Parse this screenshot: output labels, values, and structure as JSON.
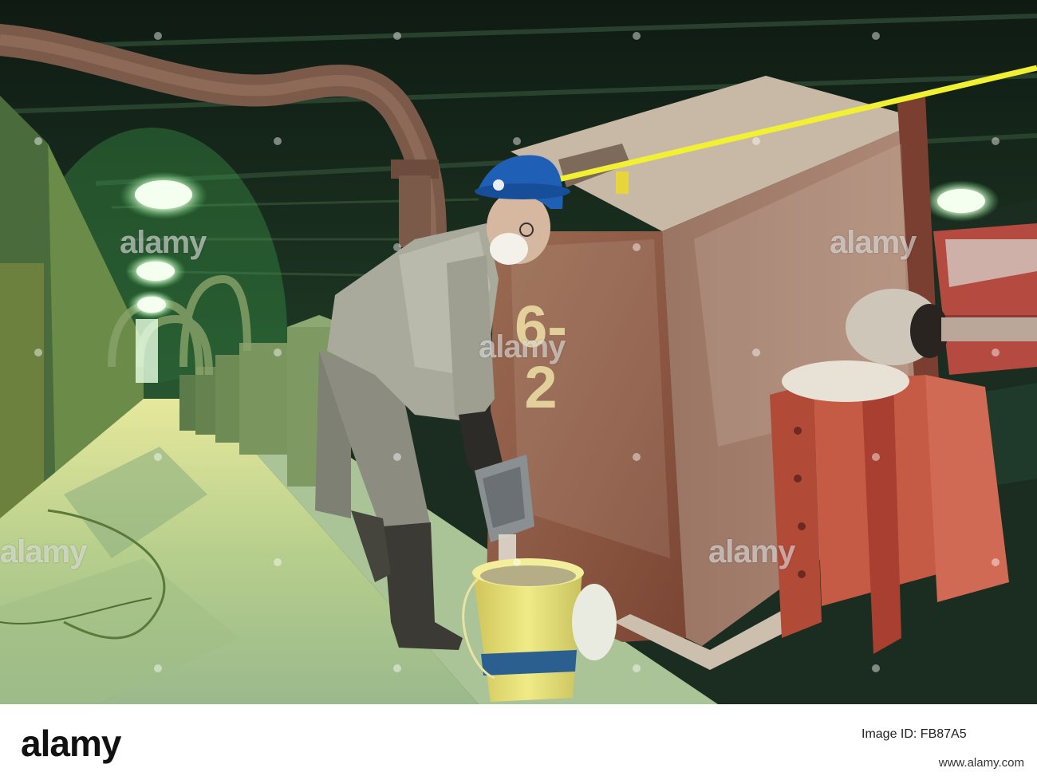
{
  "photo": {
    "machine_number": "6-2",
    "watermark_text": "alamy"
  },
  "footer": {
    "logo_text": "alamy",
    "image_id_label": "Image ID: FB87A5",
    "site_url": "www.alamy.com"
  },
  "colors": {
    "machine_rust": "#8a4a34",
    "helmet_blue": "#1f5fb5",
    "bucket_yellow": "#e6df6a",
    "floor_green": "#b8cf8a",
    "ceiling_dark": "#162219",
    "tape_yellow": "#f2f032"
  }
}
